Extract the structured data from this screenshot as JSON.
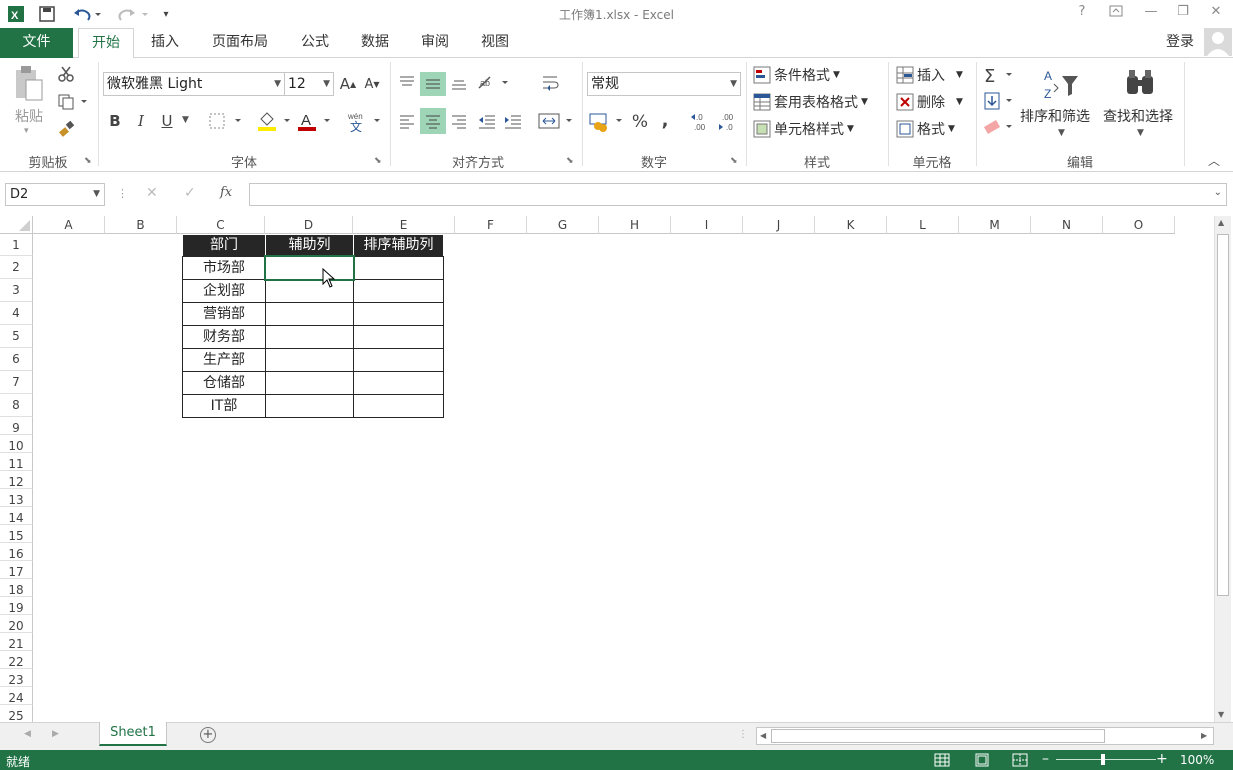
{
  "window": {
    "title": "工作簿1.xlsx - Excel",
    "help": "?",
    "minimize": "—",
    "restore": "❐",
    "close": "✕"
  },
  "tabs": [
    {
      "label": "文件"
    },
    {
      "label": "开始"
    },
    {
      "label": "插入"
    },
    {
      "label": "页面布局"
    },
    {
      "label": "公式"
    },
    {
      "label": "数据"
    },
    {
      "label": "审阅"
    },
    {
      "label": "视图"
    }
  ],
  "account": {
    "login": "登录"
  },
  "ribbon": {
    "clipboard": {
      "label": "剪贴板",
      "paste": "粘贴"
    },
    "font": {
      "label": "字体",
      "font_name": "微软雅黑 Light",
      "font_size": "12",
      "bold": "B",
      "italic": "I",
      "underline": "U"
    },
    "alignment": {
      "label": "对齐方式"
    },
    "number": {
      "label": "数字",
      "format": "常规",
      "percent": "%",
      "comma": ","
    },
    "styles": {
      "label": "样式",
      "conditional": "条件格式",
      "table": "套用表格格式",
      "cell_styles": "单元格样式"
    },
    "cells": {
      "label": "单元格",
      "insert": "插入",
      "delete": "删除",
      "format": "格式"
    },
    "editing": {
      "label": "编辑",
      "sort": "排序和筛选",
      "find": "查找和选择"
    }
  },
  "formula_bar": {
    "name_box": "D2",
    "fx": "fx",
    "value": ""
  },
  "columns": [
    "A",
    "B",
    "C",
    "D",
    "E",
    "F",
    "G",
    "H",
    "I",
    "J",
    "K",
    "L",
    "M",
    "N",
    "O"
  ],
  "rows": [
    "1",
    "2",
    "3",
    "4",
    "5",
    "6",
    "7",
    "8",
    "9",
    "10",
    "11",
    "12",
    "13",
    "14",
    "15",
    "16",
    "17",
    "18",
    "19",
    "20",
    "21",
    "22",
    "23",
    "24",
    "25"
  ],
  "table": {
    "headers": [
      "部门",
      "辅助列",
      "排序辅助列"
    ],
    "departments": [
      "市场部",
      "企划部",
      "营销部",
      "财务部",
      "生产部",
      "仓储部",
      "IT部"
    ]
  },
  "sheets": [
    {
      "name": "Sheet1"
    }
  ],
  "status": {
    "ready": "就绪",
    "zoom": "100%"
  },
  "colors": {
    "excel_green": "#217346",
    "header_fill": "#262626",
    "highlight": "#9fd5b7"
  }
}
